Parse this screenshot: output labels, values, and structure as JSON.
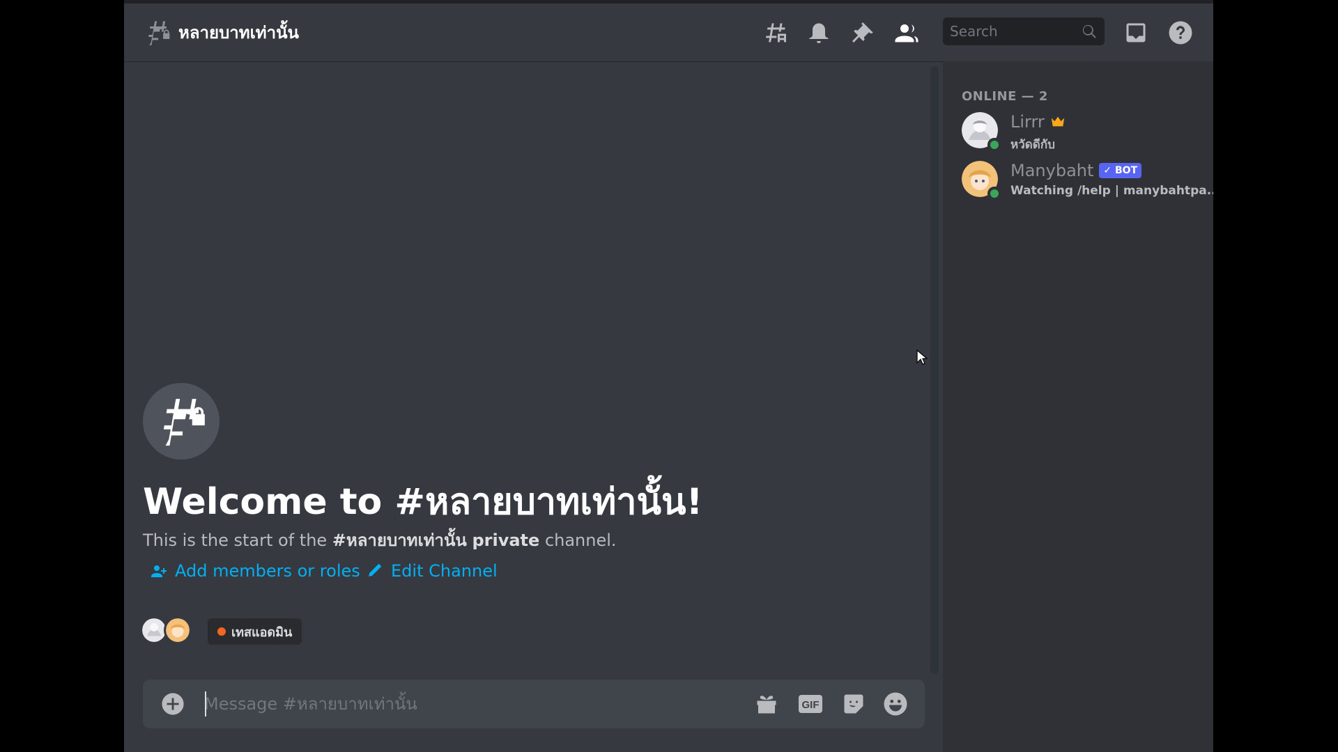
{
  "header": {
    "channel_name": "หลายบาทเท่านั้น",
    "search_placeholder": "Search"
  },
  "welcome": {
    "title": "Welcome to #หลายบาทเท่านั้น!",
    "desc_prefix": "This is the start of the ",
    "desc_channel": "#หลายบาทเท่านั้น",
    "desc_private": "private",
    "desc_suffix": " channel.",
    "add_members_label": "Add members or roles",
    "edit_channel_label": "Edit Channel",
    "role_chip_label": "เทสแอดมิน",
    "role_chip_color": "#f26522"
  },
  "composer": {
    "placeholder": "Message #หลายบาทเท่านั้น",
    "gif_label": "GIF"
  },
  "members": {
    "header": "ONLINE — 2",
    "list": [
      {
        "name": "Lirrr",
        "status_text": "หวัดดีกับ",
        "badge": "crown-icon",
        "status_color": "#3ba55c"
      },
      {
        "name": "Manybaht",
        "status_text": "Watching /help | manybahtpa...",
        "tag": "✓ BOT",
        "status_color": "#3ba55c"
      }
    ]
  },
  "colors": {
    "accent_link": "#00aff4",
    "brand": "#5865f2",
    "background": "#36393f",
    "sidebar": "#2f3136"
  }
}
